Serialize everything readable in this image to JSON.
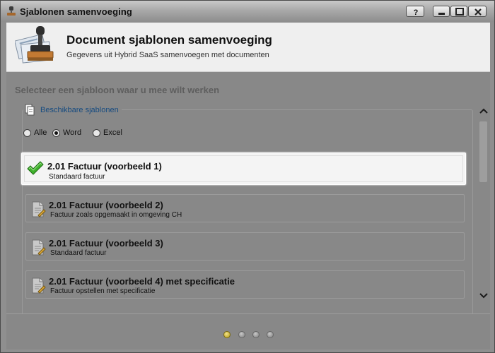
{
  "window": {
    "title": "Sjablonen samenvoeging",
    "help_label": "?"
  },
  "header": {
    "title": "Document sjablonen samenvoeging",
    "subtitle": "Gegevens uit Hybrid SaaS samenvoegen met documenten",
    "icon": "rubber-stamp-icon"
  },
  "main": {
    "section_title": "Selecteer een sjabloon waar u mee wilt werken",
    "group_label": "Beschikbare sjablonen",
    "filter": {
      "options": [
        "Alle",
        "Word",
        "Excel"
      ],
      "selected": "Word"
    },
    "templates": [
      {
        "name": "2.01 Factuur (voorbeeld 1)",
        "description": "Standaard factuur",
        "selected": true,
        "icon": "checkmark-icon"
      },
      {
        "name": "2.01 Factuur (voorbeeld 2)",
        "description": "Factuur zoals opgemaakt in omgeving CH",
        "selected": false,
        "icon": "document-icon"
      },
      {
        "name": "2.01 Factuur (voorbeeld 3)",
        "description": "Standaard factuur",
        "selected": false,
        "icon": "document-icon"
      },
      {
        "name": "2.01 Factuur (voorbeeld 4) met specificatie",
        "description": "Factuur opstellen met specificatie",
        "selected": false,
        "icon": "document-icon"
      }
    ]
  },
  "pager": {
    "pages": 4,
    "current": 1
  },
  "colors": {
    "accent_link": "#164b80",
    "check_green": "#2e9e22",
    "active_page_dot": "#d8c02a"
  }
}
